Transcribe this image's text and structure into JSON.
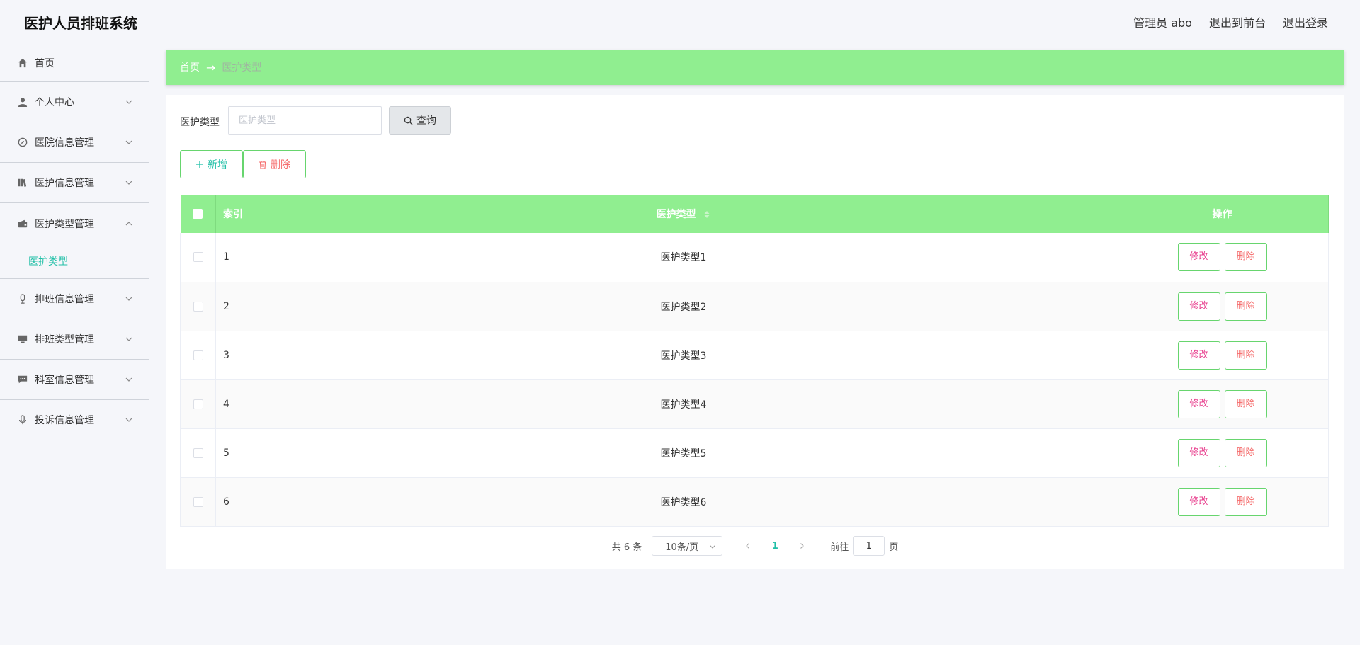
{
  "app": {
    "title": "医护人员排班系统"
  },
  "header": {
    "user": "管理员 abo",
    "to_front": "退出到前台",
    "logout": "退出登录"
  },
  "sidebar": {
    "items": [
      {
        "label": "首页",
        "icon": "home-icon"
      },
      {
        "label": "个人中心",
        "icon": "user-icon"
      },
      {
        "label": "医院信息管理",
        "icon": "compass-icon"
      },
      {
        "label": "医护信息管理",
        "icon": "books-icon"
      },
      {
        "label": "医护类型管理",
        "icon": "wallet-icon",
        "expanded": true
      },
      {
        "label": "排班信息管理",
        "icon": "microphone-icon"
      },
      {
        "label": "排班类型管理",
        "icon": "monitor-icon"
      },
      {
        "label": "科室信息管理",
        "icon": "chat-icon"
      },
      {
        "label": "投诉信息管理",
        "icon": "mic-icon"
      }
    ],
    "sub_item": "医护类型"
  },
  "breadcrumb": {
    "home": "首页",
    "separator": "→",
    "current": "医护类型"
  },
  "search": {
    "label": "医护类型",
    "placeholder": "医护类型",
    "value": "",
    "button": "查询"
  },
  "actions": {
    "add": "新增",
    "delete": "删除"
  },
  "table": {
    "headers": {
      "index": "索引",
      "type": "医护类型",
      "ops": "操作"
    },
    "rows": [
      {
        "index": "1",
        "type": "医护类型1"
      },
      {
        "index": "2",
        "type": "医护类型2"
      },
      {
        "index": "3",
        "type": "医护类型3"
      },
      {
        "index": "4",
        "type": "医护类型4"
      },
      {
        "index": "5",
        "type": "医护类型5"
      },
      {
        "index": "6",
        "type": "医护类型6"
      }
    ],
    "edit_label": "修改",
    "delete_label": "删除"
  },
  "pagination": {
    "total": "共 6 条",
    "page_size": "10条/页",
    "current_page": "1",
    "goto_prefix": "前往",
    "goto_value": "1",
    "goto_suffix": "页"
  },
  "colors": {
    "accent_green": "#90ee90",
    "teal": "#1fbfa6",
    "danger": "#f56c6c",
    "edit_pink": "#e8418f"
  }
}
